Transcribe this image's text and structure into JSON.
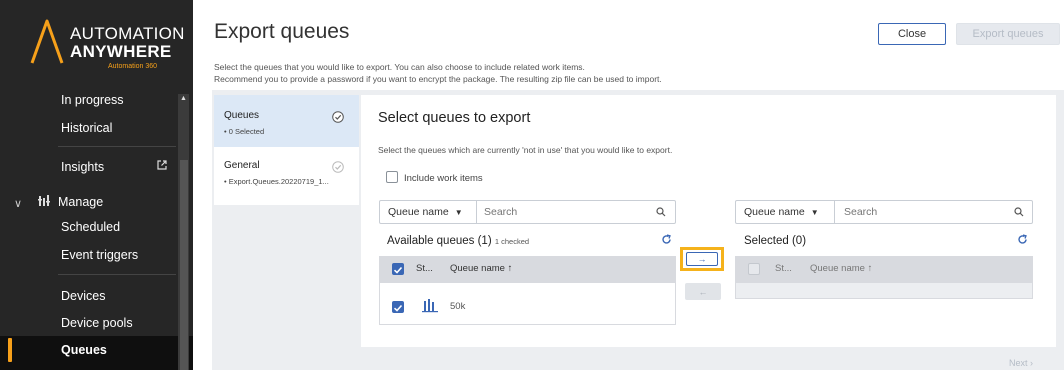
{
  "sidebar": {
    "logo": {
      "line1": "AUTOMATION",
      "line2": "ANYWHERE",
      "line3": "Automation 360"
    },
    "items": {
      "in_progress": "In progress",
      "historical": "Historical",
      "insights": "Insights",
      "manage": "Manage",
      "scheduled": "Scheduled",
      "event_triggers": "Event triggers",
      "devices": "Devices",
      "device_pools": "Device pools",
      "queues": "Queues"
    },
    "icons": {
      "insights": "external-link-icon",
      "manage": "bars-icon",
      "collapse": "chevron-down-icon"
    }
  },
  "header": {
    "title": "Export queues",
    "desc_line1": "Select the queues that you would like to export. You can also choose to include related work items.",
    "desc_line2": "Recommend you to provide a password if you want to encrypt the package. The resulting zip file can be used to import.",
    "close_label": "Close",
    "export_label": "Export queues"
  },
  "steps": [
    {
      "title": "Queues",
      "sub": "• 0 Selected",
      "active": true
    },
    {
      "title": "General",
      "sub": "• Export.Queues.20220719_1..."
    }
  ],
  "panel": {
    "title": "Select queues to export",
    "desc": "Select the queues which are currently 'not in use' that you would like to export.",
    "include_label": "Include work items",
    "include_checked": false
  },
  "left_list": {
    "filter_label": "Queue name",
    "search_placeholder": "Search",
    "title": "Available queues",
    "count": "(1)",
    "checked_note": "1 checked",
    "col_status": "St...",
    "col_name": "Queue name ↑",
    "rows": [
      {
        "name": "50k",
        "checked": true
      }
    ]
  },
  "right_list": {
    "filter_label": "Queue name",
    "search_placeholder": "Search",
    "title": "Selected",
    "count": "(0)",
    "col_status": "St...",
    "col_name": "Queue name ↑"
  },
  "transfer": {
    "right_label": "→",
    "left_label": "←"
  },
  "footer": {
    "next_label": "Next ›"
  },
  "colors": {
    "accent": "#3a67b5",
    "highlight": "#f6a01a",
    "sidebar_bg": "#262626"
  }
}
